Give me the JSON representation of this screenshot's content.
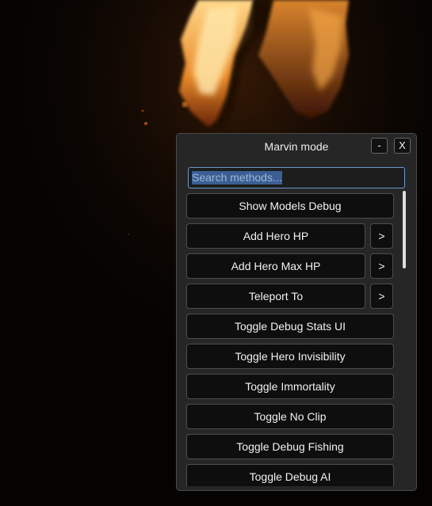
{
  "window": {
    "title": "Marvin mode",
    "minimize_label": "-",
    "close_label": "X"
  },
  "search": {
    "text": "Search methods..."
  },
  "methods": [
    {
      "label": "Show Models Debug",
      "has_arrow": false
    },
    {
      "label": "Add Hero HP",
      "has_arrow": true
    },
    {
      "label": "Add Hero Max HP",
      "has_arrow": true
    },
    {
      "label": "Teleport To",
      "has_arrow": true
    },
    {
      "label": "Toggle Debug Stats UI",
      "has_arrow": false
    },
    {
      "label": "Toggle Hero Invisibility",
      "has_arrow": false
    },
    {
      "label": "Toggle Immortality",
      "has_arrow": false
    },
    {
      "label": "Toggle No Clip",
      "has_arrow": false
    },
    {
      "label": "Toggle Debug Fishing",
      "has_arrow": false
    },
    {
      "label": "Toggle Debug AI",
      "has_arrow": false
    }
  ],
  "arrow_label": ">",
  "colors": {
    "panel_bg": "#262626",
    "button_bg": "#0e0e0e",
    "search_border": "#6c9ad0",
    "search_selection": "#3b5f92",
    "fire_core": "#ffe9a0",
    "fire_mid": "#f2a23a",
    "fire_edge": "#8a3a0c"
  }
}
